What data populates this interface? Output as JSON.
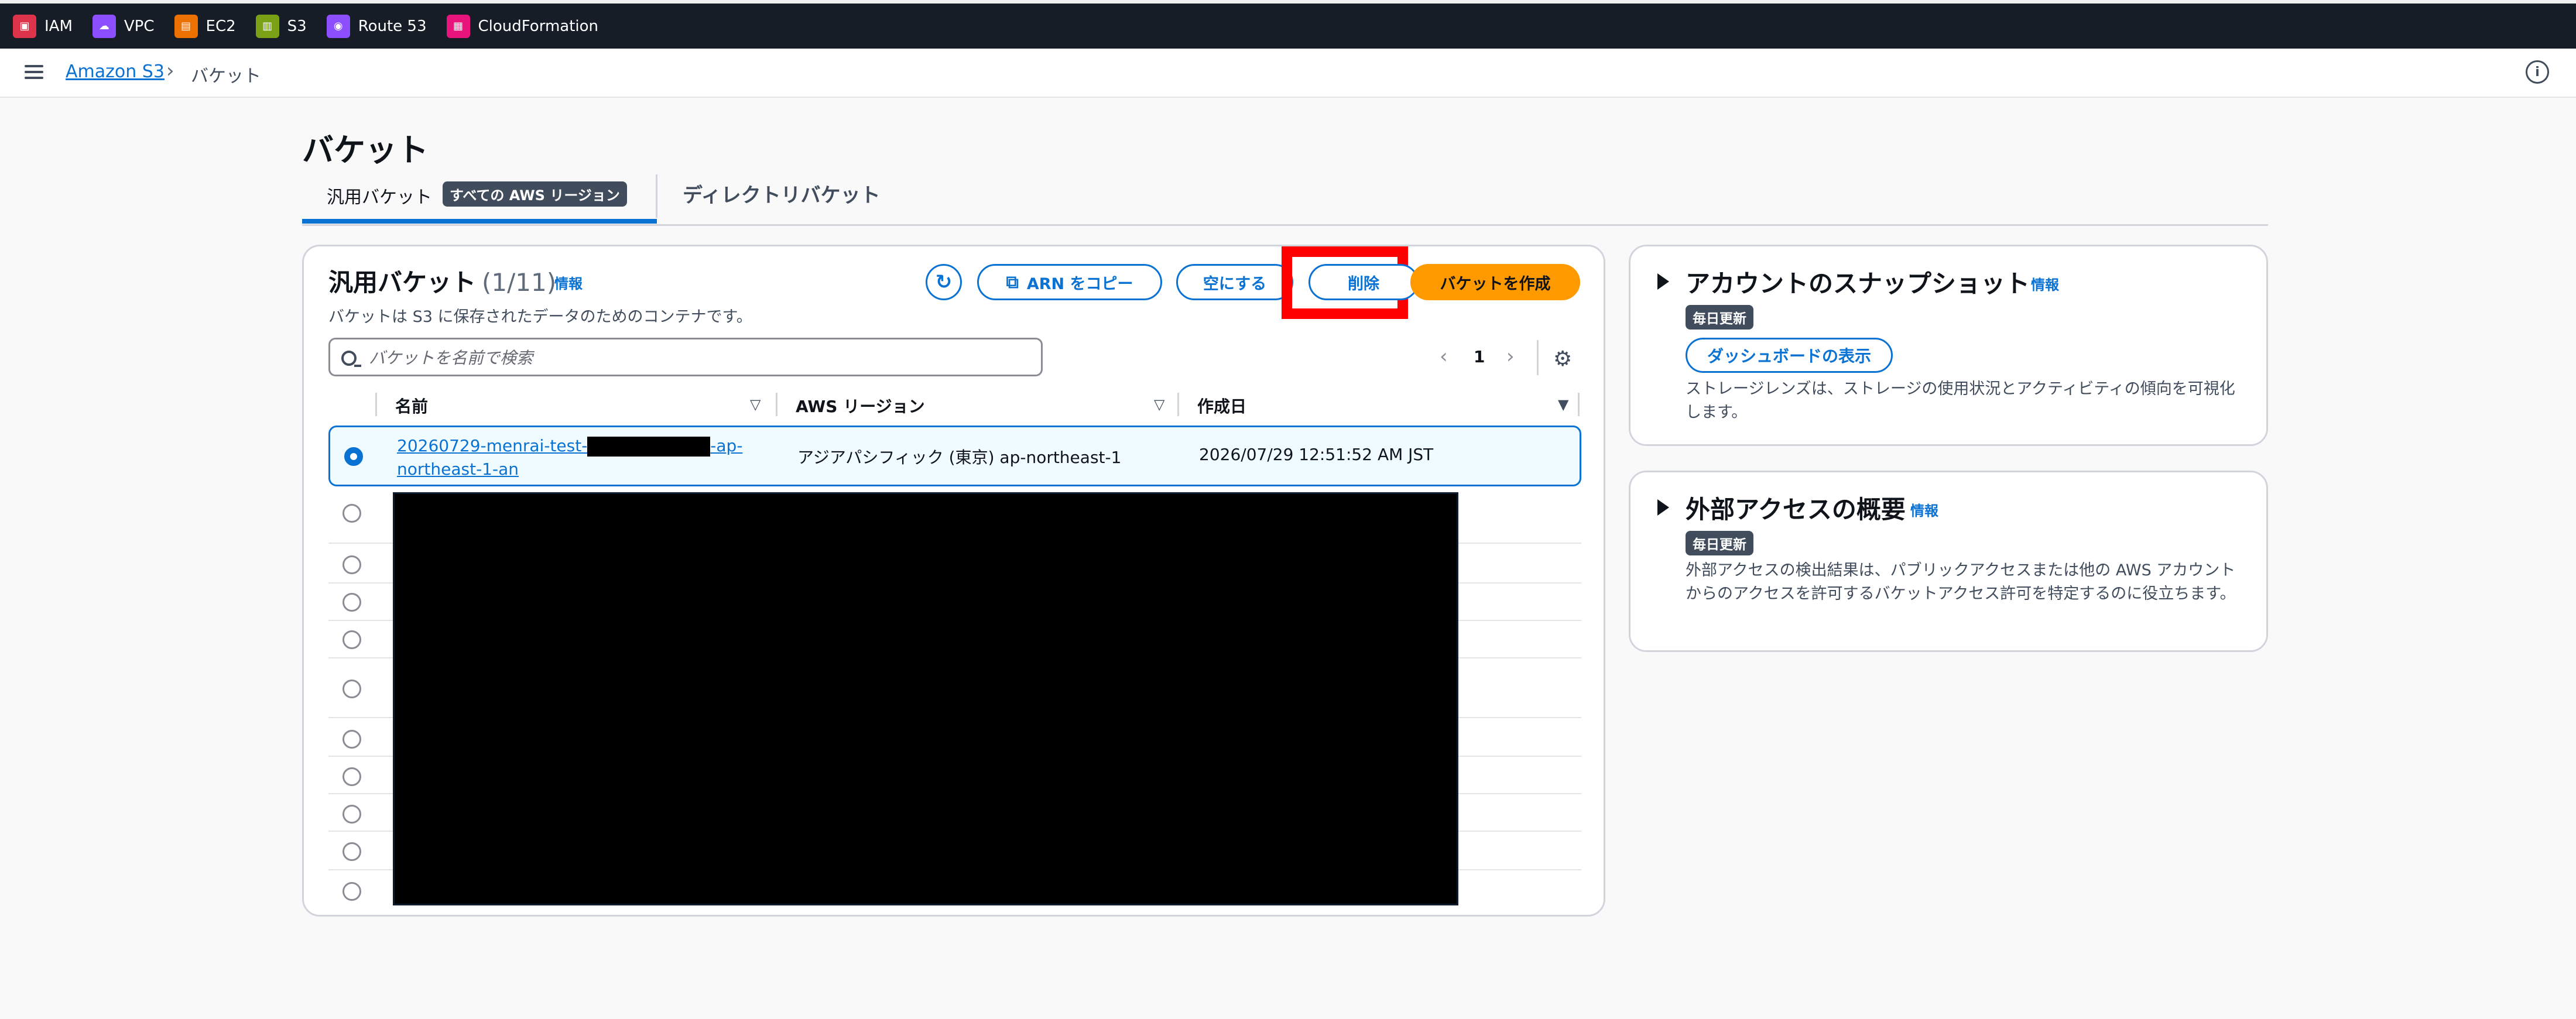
{
  "topbar": {
    "services": [
      {
        "label": "IAM",
        "color": "#dd344c",
        "icon": "iam-icon"
      },
      {
        "label": "VPC",
        "color": "#8c4fff",
        "icon": "vpc-icon"
      },
      {
        "label": "EC2",
        "color": "#ed7100",
        "icon": "ec2-icon"
      },
      {
        "label": "S3",
        "color": "#7aa116",
        "icon": "s3-icon"
      },
      {
        "label": "Route 53",
        "color": "#8c4fff",
        "icon": "route53-icon"
      },
      {
        "label": "CloudFormation",
        "color": "#e7157b",
        "icon": "cloudformation-icon"
      }
    ]
  },
  "breadcrumb": {
    "root": "Amazon S3",
    "current": "バケット"
  },
  "page": {
    "title": "バケット"
  },
  "tabs": {
    "general": "汎用バケット",
    "general_badge": "すべての AWS リージョン",
    "directory": "ディレクトリバケット"
  },
  "buckets_panel": {
    "title": "汎用バケット",
    "count": "(1/11)",
    "info": "情報",
    "description": "バケットは S3 に保存されたデータのためのコンテナです。",
    "buttons": {
      "copy_arn": "ARN をコピー",
      "empty": "空にする",
      "delete": "削除",
      "create": "バケットを作成"
    },
    "search_placeholder": "バケットを名前で検索",
    "page_number": "1",
    "columns": {
      "name": "名前",
      "region": "AWS リージョン",
      "created": "作成日"
    },
    "selected_row": {
      "name_prefix": "20260729-menrai-test-",
      "name_suffix": "-ap-northeast-1-an",
      "region": "アジアパシフィック (東京) ap-northeast-1",
      "created": "2026/07/29 12:51:52 AM JST"
    }
  },
  "snapshot": {
    "title": "アカウントのスナップショット",
    "info": "情報",
    "badge": "毎日更新",
    "button": "ダッシュボードの表示",
    "text": "ストレージレンズは、ストレージの使用状況とアクティビティの傾向を可視化します。"
  },
  "external_access": {
    "title": "外部アクセスの概要",
    "info": "情報",
    "badge": "毎日更新",
    "text": "外部アクセスの検出結果は、パブリックアクセスまたは他の AWS アカウントからのアクセスを許可するバケットアクセス許可を特定するのに役立ちます。"
  },
  "colors": {
    "accent": "#0972d3",
    "create_button": "#ff9900",
    "highlight": "#ff0000",
    "topbar": "#161d26"
  }
}
